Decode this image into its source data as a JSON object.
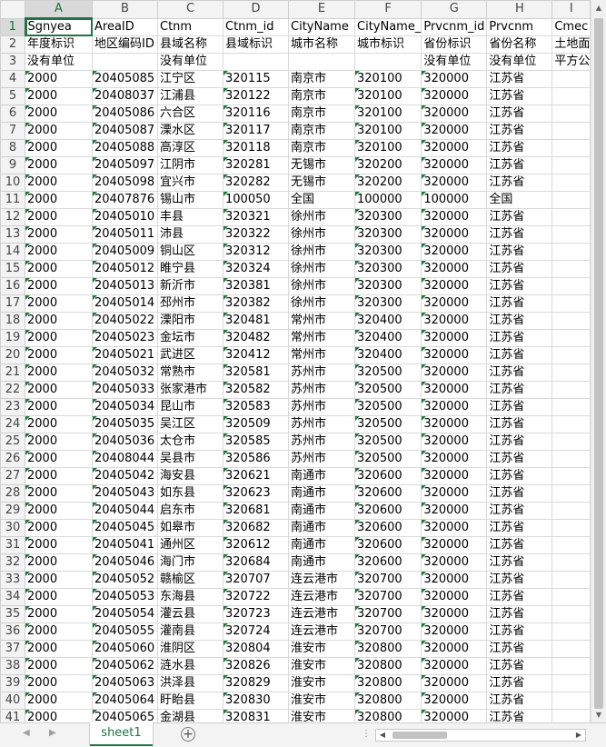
{
  "columns": [
    "A",
    "B",
    "C",
    "D",
    "E",
    "F",
    "G",
    "H",
    "I"
  ],
  "rows": [
    [
      "Sgnyea",
      "AreaID",
      "Ctnm",
      "Ctnm_id",
      "CityName",
      "CityName_",
      "Prvcnm_id",
      "Prvcnm",
      "Cmec"
    ],
    [
      "年度标识",
      "地区编码ID",
      "县域名称",
      "县域标识",
      "城市名称",
      "城市标识",
      "省份标识",
      "省份名称",
      "土地面"
    ],
    [
      "没有单位",
      "",
      "没有单位",
      "",
      "",
      "",
      "没有单位",
      "没有单位",
      "平方公"
    ],
    [
      "2000",
      "20405085",
      "江宁区",
      "320115",
      "南京市",
      "320100",
      "320000",
      "江苏省",
      ""
    ],
    [
      "2000",
      "20408037",
      "江浦县",
      "320122",
      "南京市",
      "320100",
      "320000",
      "江苏省",
      ""
    ],
    [
      "2000",
      "20405086",
      "六合区",
      "320116",
      "南京市",
      "320100",
      "320000",
      "江苏省",
      ""
    ],
    [
      "2000",
      "20405087",
      "溧水区",
      "320117",
      "南京市",
      "320100",
      "320000",
      "江苏省",
      ""
    ],
    [
      "2000",
      "20405088",
      "高淳区",
      "320118",
      "南京市",
      "320100",
      "320000",
      "江苏省",
      ""
    ],
    [
      "2000",
      "20405097",
      "江阴市",
      "320281",
      "无锡市",
      "320200",
      "320000",
      "江苏省",
      ""
    ],
    [
      "2000",
      "20405098",
      "宜兴市",
      "320282",
      "无锡市",
      "320200",
      "320000",
      "江苏省",
      ""
    ],
    [
      "2000",
      "20407876",
      "锡山市",
      "100050",
      "全国",
      "100000",
      "100000",
      "全国",
      ""
    ],
    [
      "2000",
      "20405010",
      "丰县",
      "320321",
      "徐州市",
      "320300",
      "320000",
      "江苏省",
      ""
    ],
    [
      "2000",
      "20405011",
      "沛县",
      "320322",
      "徐州市",
      "320300",
      "320000",
      "江苏省",
      ""
    ],
    [
      "2000",
      "20405009",
      "铜山区",
      "320312",
      "徐州市",
      "320300",
      "320000",
      "江苏省",
      ""
    ],
    [
      "2000",
      "20405012",
      "睢宁县",
      "320324",
      "徐州市",
      "320300",
      "320000",
      "江苏省",
      ""
    ],
    [
      "2000",
      "20405013",
      "新沂市",
      "320381",
      "徐州市",
      "320300",
      "320000",
      "江苏省",
      ""
    ],
    [
      "2000",
      "20405014",
      "邳州市",
      "320382",
      "徐州市",
      "320300",
      "320000",
      "江苏省",
      ""
    ],
    [
      "2000",
      "20405022",
      "溧阳市",
      "320481",
      "常州市",
      "320400",
      "320000",
      "江苏省",
      ""
    ],
    [
      "2000",
      "20405023",
      "金坛市",
      "320482",
      "常州市",
      "320400",
      "320000",
      "江苏省",
      ""
    ],
    [
      "2000",
      "20405021",
      "武进区",
      "320412",
      "常州市",
      "320400",
      "320000",
      "江苏省",
      ""
    ],
    [
      "2000",
      "20405032",
      "常熟市",
      "320581",
      "苏州市",
      "320500",
      "320000",
      "江苏省",
      ""
    ],
    [
      "2000",
      "20405033",
      "张家港市",
      "320582",
      "苏州市",
      "320500",
      "320000",
      "江苏省",
      ""
    ],
    [
      "2000",
      "20405034",
      "昆山市",
      "320583",
      "苏州市",
      "320500",
      "320000",
      "江苏省",
      ""
    ],
    [
      "2000",
      "20405035",
      "吴江区",
      "320509",
      "苏州市",
      "320500",
      "320000",
      "江苏省",
      ""
    ],
    [
      "2000",
      "20405036",
      "太仓市",
      "320585",
      "苏州市",
      "320500",
      "320000",
      "江苏省",
      ""
    ],
    [
      "2000",
      "20408044",
      "吴县市",
      "320586",
      "苏州市",
      "320500",
      "320000",
      "江苏省",
      ""
    ],
    [
      "2000",
      "20405042",
      "海安县",
      "320621",
      "南通市",
      "320600",
      "320000",
      "江苏省",
      ""
    ],
    [
      "2000",
      "20405043",
      "如东县",
      "320623",
      "南通市",
      "320600",
      "320000",
      "江苏省",
      ""
    ],
    [
      "2000",
      "20405044",
      "启东市",
      "320681",
      "南通市",
      "320600",
      "320000",
      "江苏省",
      ""
    ],
    [
      "2000",
      "20405045",
      "如皋市",
      "320682",
      "南通市",
      "320600",
      "320000",
      "江苏省",
      ""
    ],
    [
      "2000",
      "20405041",
      "通州区",
      "320612",
      "南通市",
      "320600",
      "320000",
      "江苏省",
      ""
    ],
    [
      "2000",
      "20405046",
      "海门市",
      "320684",
      "南通市",
      "320600",
      "320000",
      "江苏省",
      ""
    ],
    [
      "2000",
      "20405052",
      "赣榆区",
      "320707",
      "连云港市",
      "320700",
      "320000",
      "江苏省",
      ""
    ],
    [
      "2000",
      "20405053",
      "东海县",
      "320722",
      "连云港市",
      "320700",
      "320000",
      "江苏省",
      ""
    ],
    [
      "2000",
      "20405054",
      "灌云县",
      "320723",
      "连云港市",
      "320700",
      "320000",
      "江苏省",
      ""
    ],
    [
      "2000",
      "20405055",
      "灌南县",
      "320724",
      "连云港市",
      "320700",
      "320000",
      "江苏省",
      ""
    ],
    [
      "2000",
      "20405060",
      "淮阴区",
      "320804",
      "淮安市",
      "320800",
      "320000",
      "江苏省",
      ""
    ],
    [
      "2000",
      "20405062",
      "涟水县",
      "320826",
      "淮安市",
      "320800",
      "320000",
      "江苏省",
      ""
    ],
    [
      "2000",
      "20405063",
      "洪泽县",
      "320829",
      "淮安市",
      "320800",
      "320000",
      "江苏省",
      ""
    ],
    [
      "2000",
      "20405064",
      "盱眙县",
      "320830",
      "淮安市",
      "320800",
      "320000",
      "江苏省",
      ""
    ],
    [
      "2000",
      "20405065",
      "金湖县",
      "320831",
      "淮安市",
      "320800",
      "320000",
      "江苏省",
      ""
    ]
  ],
  "sheet_tab": "sheet1",
  "icons": {
    "nav_prev": "triangle-left-icon",
    "nav_next": "triangle-right-icon",
    "add_sheet": "plus-circle-icon",
    "more": "ellipsis-icon"
  },
  "colors": {
    "accent": "#217346",
    "error_marker": "#1d7a3c"
  }
}
